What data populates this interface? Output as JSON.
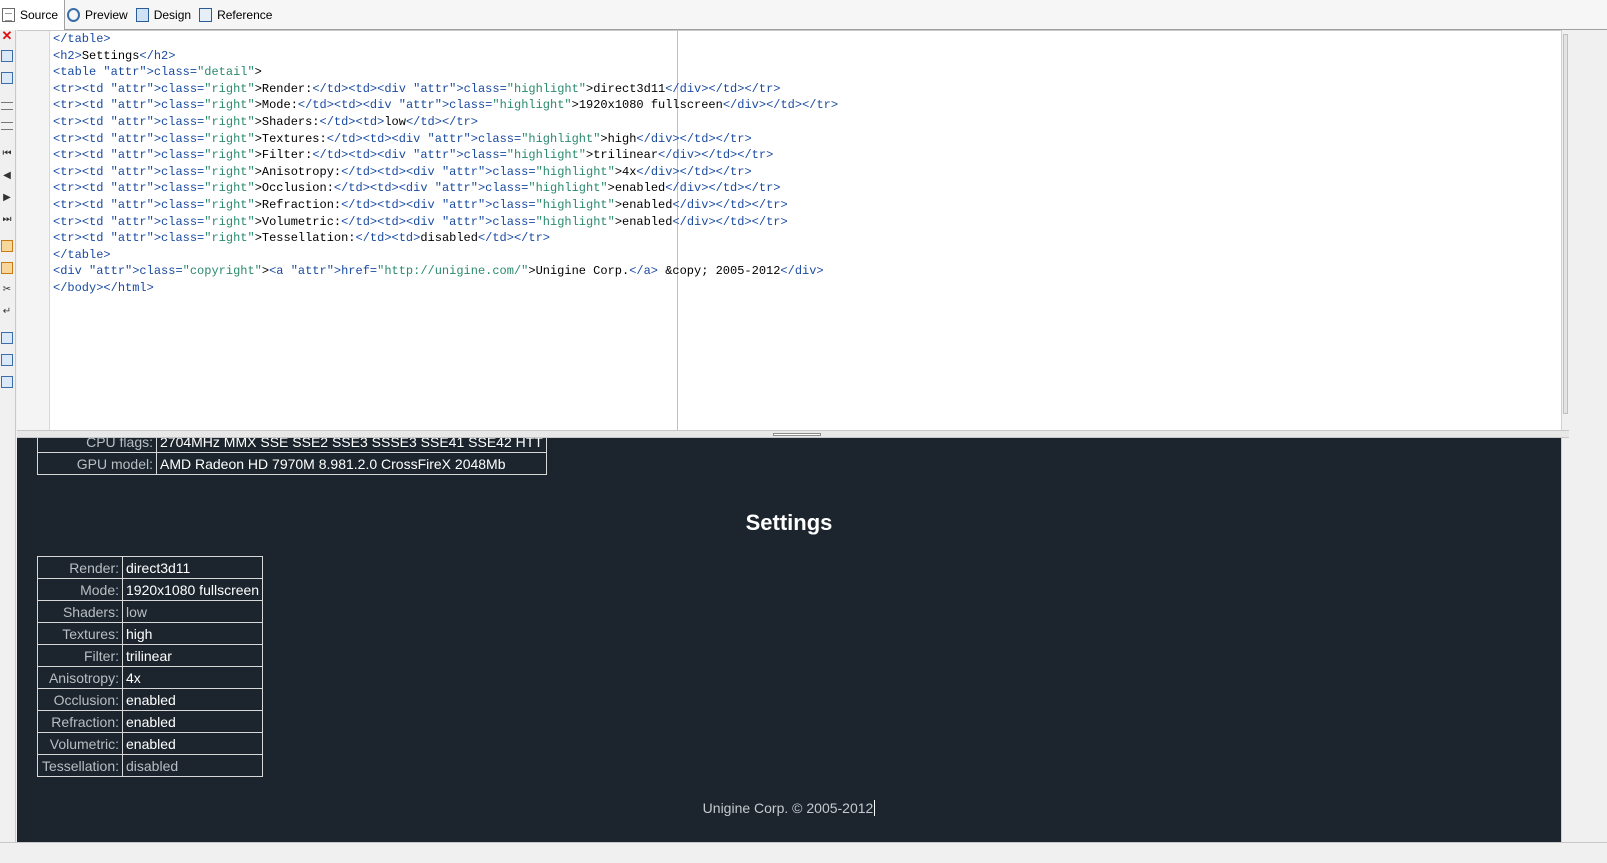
{
  "tabs": [
    {
      "label": "Source",
      "icon": "source-page-icon",
      "active": true
    },
    {
      "label": "Preview",
      "icon": "preview-magnifier-icon",
      "active": false
    },
    {
      "label": "Design",
      "icon": "design-monitor-icon",
      "active": false
    },
    {
      "label": "Reference",
      "icon": "reference-book-icon",
      "active": false
    }
  ],
  "source_lines": [
    "</table>",
    "<h2>Settings</h2>",
    "<table class=\"detail\">",
    "<tr><td class=\"right\">Render:</td><td><div class=\"highlight\">direct3d11</div></td></tr>",
    "<tr><td class=\"right\">Mode:</td><td><div class=\"highlight\">1920x1080 fullscreen</div></td></tr>",
    "<tr><td class=\"right\">Shaders:</td><td>low</td></tr>",
    "<tr><td class=\"right\">Textures:</td><td><div class=\"highlight\">high</div></td></tr>",
    "<tr><td class=\"right\">Filter:</td><td><div class=\"highlight\">trilinear</div></td></tr>",
    "<tr><td class=\"right\">Anisotropy:</td><td><div class=\"highlight\">4x</div></td></tr>",
    "<tr><td class=\"right\">Occlusion:</td><td><div class=\"highlight\">enabled</div></td></tr>",
    "<tr><td class=\"right\">Refraction:</td><td><div class=\"highlight\">enabled</div></td></tr>",
    "<tr><td class=\"right\">Volumetric:</td><td><div class=\"highlight\">enabled</div></td></tr>",
    "<tr><td class=\"right\">Tessellation:</td><td>disabled</td></tr>",
    "</table>",
    "<div class=\"copyright\"><a href=\"http://unigine.com/\">Unigine Corp.</a> &copy; 2005-2012</div>",
    "</body></html>"
  ],
  "preview": {
    "system_rows": [
      {
        "label": "CPU flags:",
        "value": "2704MHz MMX SSE SSE2 SSE3 SSSE3 SSE41 SSE42 HTT"
      },
      {
        "label": "GPU model:",
        "value": "AMD Radeon HD 7970M 8.981.2.0 CrossFireX 2048Mb"
      }
    ],
    "settings_title": "Settings",
    "settings_rows": [
      {
        "label": "Render:",
        "value": "direct3d11",
        "highlight": true
      },
      {
        "label": "Mode:",
        "value": "1920x1080 fullscreen",
        "highlight": true
      },
      {
        "label": "Shaders:",
        "value": "low",
        "highlight": false
      },
      {
        "label": "Textures:",
        "value": "high",
        "highlight": true
      },
      {
        "label": "Filter:",
        "value": "trilinear",
        "highlight": true
      },
      {
        "label": "Anisotropy:",
        "value": "4x",
        "highlight": true
      },
      {
        "label": "Occlusion:",
        "value": "enabled",
        "highlight": true
      },
      {
        "label": "Refraction:",
        "value": "enabled",
        "highlight": true
      },
      {
        "label": "Volumetric:",
        "value": "enabled",
        "highlight": true
      },
      {
        "label": "Tessellation:",
        "value": "disabled",
        "highlight": false
      }
    ],
    "copyright_link": "Unigine Corp.",
    "copyright_text": " © 2005-2012"
  },
  "colors": {
    "preview_background": "#1c252d",
    "tag_color": "#1a4ba0",
    "attribute_color": "#2a8a6e"
  }
}
